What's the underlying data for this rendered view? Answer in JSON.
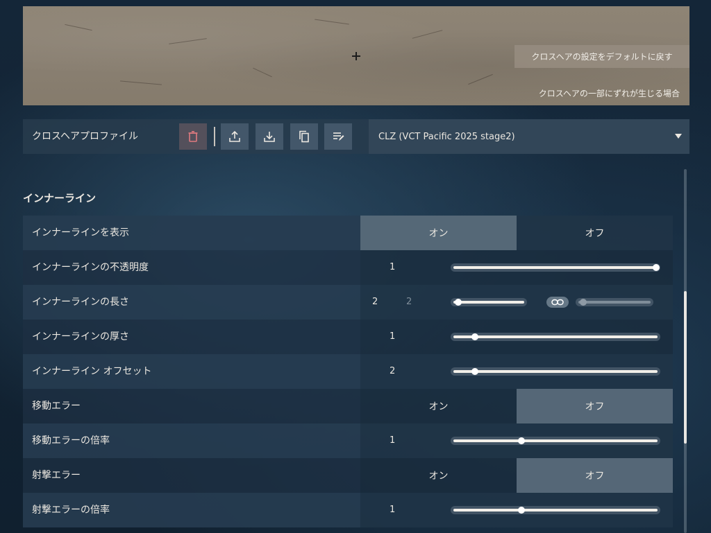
{
  "preview": {
    "reset_label": "クロスヘアの設定をデフォルトに戻す",
    "offset_note": "クロスヘアの一部にずれが生じる場合"
  },
  "profile": {
    "label": "クロスヘアプロファイル",
    "selected": "CLZ (VCT Pacific 2025 stage2)",
    "tools": [
      "trash-icon",
      "upload-icon",
      "download-icon",
      "copy-icon",
      "rename-icon"
    ]
  },
  "section": {
    "title": "インナーライン",
    "rows": {
      "show": {
        "label": "インナーラインを表示",
        "on": "オン",
        "off": "オフ",
        "selected": "on"
      },
      "opacity": {
        "label": "インナーラインの不透明度",
        "value": "1",
        "fraction": 1.0
      },
      "length": {
        "label": "インナーラインの長さ",
        "value": "2",
        "value2": "2",
        "fraction": 0.05,
        "fraction2": 0.05
      },
      "thickness": {
        "label": "インナーラインの厚さ",
        "value": "1",
        "fraction": 0.1
      },
      "offset": {
        "label": "インナーライン オフセット",
        "value": "2",
        "fraction": 0.1
      },
      "move_error": {
        "label": "移動エラー",
        "on": "オン",
        "off": "オフ",
        "selected": "off"
      },
      "move_mult": {
        "label": "移動エラーの倍率",
        "value": "1",
        "fraction": 0.33
      },
      "fire_error": {
        "label": "射撃エラー",
        "on": "オン",
        "off": "オフ",
        "selected": "off"
      },
      "fire_mult": {
        "label": "射撃エラーの倍率",
        "value": "1",
        "fraction": 0.33
      }
    }
  },
  "colors": {
    "accent": "#f2efe9",
    "danger_icon": "#e07a80"
  }
}
